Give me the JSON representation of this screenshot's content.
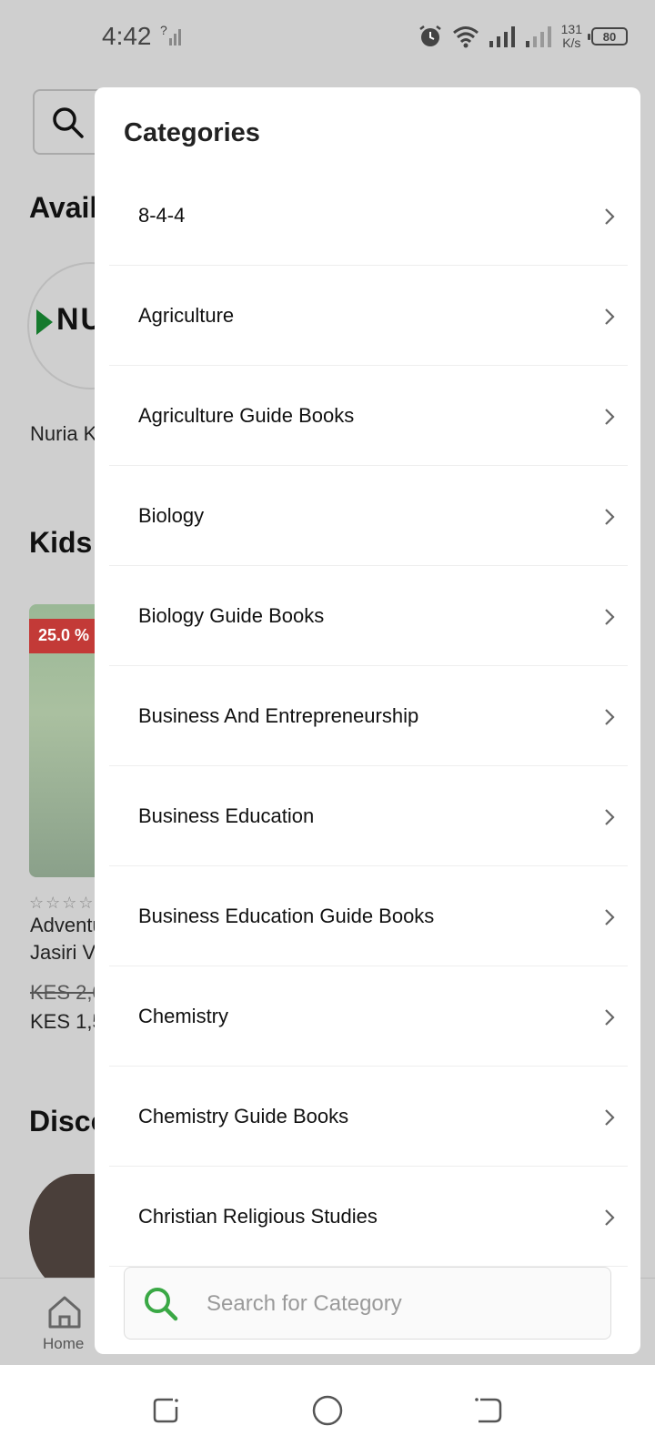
{
  "status_bar": {
    "time": "4:42",
    "net_speed_value": "131",
    "net_speed_unit": "K/s",
    "battery": "80"
  },
  "background": {
    "heading_available": "Avail",
    "publisher_label": "Nuria K",
    "logo_text": "NU",
    "heading_kids": "Kids",
    "discount_badge": "25.0 %",
    "book_title_line1": "Adventu",
    "book_title_line2": "Jasiri Ve",
    "old_price": "KES 2,0",
    "new_price": "KES 1,5",
    "heading_discover": "Disco",
    "nav_home": "Home"
  },
  "sheet": {
    "title": "Categories",
    "categories": [
      {
        "label": "8-4-4"
      },
      {
        "label": "Agriculture"
      },
      {
        "label": "Agriculture Guide Books"
      },
      {
        "label": "Biology"
      },
      {
        "label": "Biology Guide Books"
      },
      {
        "label": "Business And Entrepreneurship"
      },
      {
        "label": "Business Education"
      },
      {
        "label": "Business Education Guide Books"
      },
      {
        "label": "Chemistry"
      },
      {
        "label": "Chemistry Guide Books"
      },
      {
        "label": "Christian Religious Studies"
      }
    ],
    "search": {
      "placeholder": "Search for Category",
      "value": "",
      "icon_color": "#3aa845"
    }
  }
}
